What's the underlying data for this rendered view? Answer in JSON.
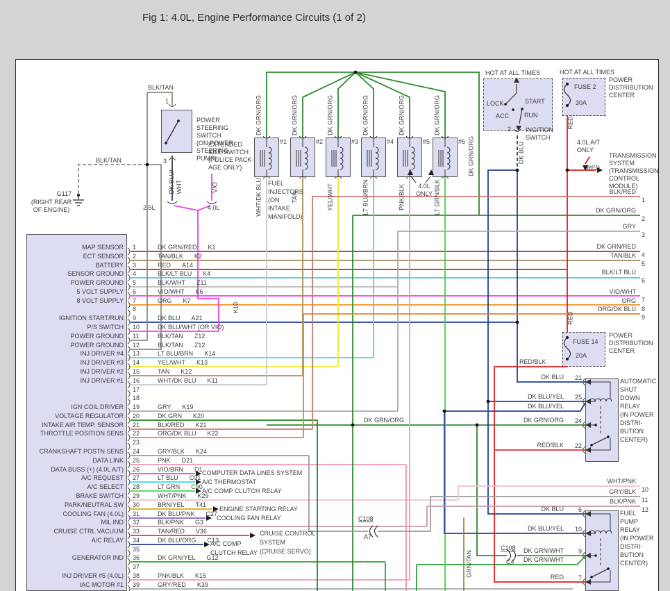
{
  "title": "Fig 1: 4.0L, Engine Performance Circuits (1 of 2)",
  "colors": {
    "DK GRN/RED": "#9b3a32",
    "TAN/BLK": "#a08a5a",
    "RED": "#e31b1b",
    "BLK/LT BLU": "#4cc7c7",
    "BLK/WHT": "#b8b8b8",
    "VIO/WHT": "#ef3fe8",
    "ORG": "#f0921e",
    "DK BLU": "#20409a",
    "DK BLU/WHT (OR VIO)": "#ef3fe8",
    "BLK/TAN": "#8d8d83",
    "LT BLU/BRN": "#35dede",
    "YEL/WHT": "#ecec22",
    "TAN": "#ab9154",
    "WHT/DK BLU": "#c9c9d2",
    "GRY": "#ababab",
    "DK GRN": "#1d8a1d",
    "BLK/RED": "#c77a70",
    "ORG/DK BLU": "#e0862b",
    "GRY/BLK": "#9b9b9b",
    "PNK": "#f392b4",
    "VIO/BRN": "#e044e0",
    "LT BLU": "#2bdede",
    "LT GRN": "#46d846",
    "WHT/PNK": "#eec3cd",
    "BRN/YEL": "#cfae00",
    "DK BLU/PNK": "#8166c4",
    "BLK/PNK": "#c59ba6",
    "TAN/RED": "#d9412b",
    "DK BLU/ORG": "#273694",
    "DK GRN/YEL": "#2da42d",
    "PNK/BLK": "#f09cae",
    "GRY/RED": "#a6a6a6",
    "DK GRN/ORG": "#2e8b2e",
    "LT GRN/BLK": "#4ccf4c",
    "DK GRN/WHT": "#2f9e38",
    "DK BLU/YEL": "#2a3f9e",
    "RED/BLK": "#e33535",
    "GRN/TAN": "#7d9a48",
    "BLK": "#3c3c3c"
  },
  "left_connector": {
    "rows": [
      {
        "n": "1",
        "label": "MAP SENSOR",
        "wire": "DK GRN/RED",
        "code": "K1"
      },
      {
        "n": "2",
        "label": "ECT SENSOR",
        "wire": "TAN/BLK",
        "code": "K2"
      },
      {
        "n": "3",
        "label": "BATTERY",
        "wire": "RED",
        "code": "A14"
      },
      {
        "n": "4",
        "label": "SENSOR GROUND",
        "wire": "BLK/LT BLU",
        "code": "K4"
      },
      {
        "n": "5",
        "label": "POWER GROUND",
        "wire": "BLK/WHT",
        "code": "Z11"
      },
      {
        "n": "6",
        "label": "5 VOLT SUPPLY",
        "wire": "VIO/WHT",
        "code": "K6"
      },
      {
        "n": "7",
        "label": "8 VOLT SUPPLY",
        "wire": "ORG",
        "code": "K7"
      },
      {
        "n": "8",
        "label": "",
        "wire": "",
        "code": ""
      },
      {
        "n": "9",
        "label": "IGNITION START/RUN",
        "wire": "DK BLU",
        "code": "A21"
      },
      {
        "n": "10",
        "label": "P/S SWITCH",
        "wire": "DK BLU/WHT (OR VIO)",
        "code": ""
      },
      {
        "n": "11",
        "label": "POWER GROUND",
        "wire": "BLK/TAN",
        "code": "Z12"
      },
      {
        "n": "12",
        "label": "POWER GROUND",
        "wire": "BLK/TAN",
        "code": "Z12"
      },
      {
        "n": "13",
        "label": "INJ DRIVER #4",
        "wire": "LT BLU/BRN",
        "code": "K14"
      },
      {
        "n": "14",
        "label": "INJ DRIVER #3",
        "wire": "YEL/WHT",
        "code": "K13"
      },
      {
        "n": "15",
        "label": "INJ DRIVER #2",
        "wire": "TAN",
        "code": "K12"
      },
      {
        "n": "16",
        "label": "INJ DRIVER #1",
        "wire": "WHT/DK BLU",
        "code": "K11"
      },
      {
        "n": "17",
        "label": "",
        "wire": "",
        "code": ""
      },
      {
        "n": "18",
        "label": "",
        "wire": "",
        "code": ""
      },
      {
        "n": "19",
        "label": "IGN COIL DRIVER",
        "wire": "GRY",
        "code": "K19"
      },
      {
        "n": "20",
        "label": "VOLTAGE REGULATOR",
        "wire": "DK GRN",
        "code": "K20"
      },
      {
        "n": "21",
        "label": "INTAKE AIR TEMP. SENSOR",
        "wire": "BLK/RED",
        "code": "K21"
      },
      {
        "n": "22",
        "label": "THROTTLE POSITION SENS",
        "wire": "ORG/DK BLU",
        "code": "K22"
      },
      {
        "n": "23",
        "label": "",
        "wire": "",
        "code": ""
      },
      {
        "n": "24",
        "label": "CRANKSHAFT POSTN SENS",
        "wire": "GRY/BLK",
        "code": "K24"
      },
      {
        "n": "25",
        "label": "DATA LINK",
        "wire": "PNK",
        "code": "D21"
      },
      {
        "n": "26",
        "label": "DATA BUSS (+) (4.0L A/T)",
        "wire": "VIO/BRN",
        "code": "D1"
      },
      {
        "n": "27",
        "label": "A/C REQUEST",
        "wire": "LT BLU",
        "code": "C91"
      },
      {
        "n": "28",
        "label": "A/C SELECT",
        "wire": "LT GRN",
        "code": "C90"
      },
      {
        "n": "29",
        "label": "BRAKE SWITCH",
        "wire": "WHT/PNK",
        "code": "K29"
      },
      {
        "n": "30",
        "label": "PARK/NEUTRAL SW",
        "wire": "BRN/YEL",
        "code": "T41"
      },
      {
        "n": "31",
        "label": "COOLING FAN (4.0L)",
        "wire": "DK BLU/PNK",
        "code": "C27"
      },
      {
        "n": "32",
        "label": "MIL IND",
        "wire": "BLK/PNK",
        "code": "G3"
      },
      {
        "n": "33",
        "label": "CRUISE CTRL VACUUM",
        "wire": "TAN/RED",
        "code": "V36"
      },
      {
        "n": "34",
        "label": "A/C RELAY",
        "wire": "DK BLU/ORG",
        "code": "C13"
      },
      {
        "n": "35",
        "label": "",
        "wire": "",
        "code": ""
      },
      {
        "n": "36",
        "label": "GENERATOR IND",
        "wire": "DK GRN/YEL",
        "code": "G12"
      },
      {
        "n": "37",
        "label": "",
        "wire": "",
        "code": ""
      },
      {
        "n": "38",
        "label": "INJ DRIVER #5 (4.0L)",
        "wire": "PNK/BLK",
        "code": "K15"
      },
      {
        "n": "39",
        "label": "IAC MOTOR #1",
        "wire": "GRY/RED",
        "code": "K39"
      }
    ]
  },
  "right_pins": [
    {
      "wire": "BLK/RED",
      "n": "1"
    },
    {
      "wire": "DK GRN/ORG",
      "n": "2"
    },
    {
      "wire": "GRY",
      "n": "3"
    },
    {
      "wire": "DK GRN/RED",
      "n": "4"
    },
    {
      "wire": "TAN/BLK",
      "n": "5"
    },
    {
      "wire": "BLK/LT BLU",
      "n": "6"
    },
    {
      "wire": "VIO/WHT",
      "n": "7"
    },
    {
      "wire": "ORG",
      "n": "8"
    },
    {
      "wire": "ORG/DK BLU",
      "n": "9"
    },
    {
      "wire": "WHT/PNK",
      "n": "10"
    },
    {
      "wire": "GRY/BLK",
      "n": "11"
    },
    {
      "wire": "BLK/PNK",
      "n": "12"
    }
  ],
  "injectors": {
    "title": "FUEL\nINJECTORS\n(ON\nINTAKE\nMANIFOLD)",
    "top_wire": "DK GRN/ORG",
    "right_wire": "DK GRN/ORG",
    "note": "4.0L\nONLY",
    "items": [
      {
        "n": "#1",
        "wire": "WHT/DK BLU"
      },
      {
        "n": "#2",
        "wire": "TAN"
      },
      {
        "n": "#3",
        "wire": "YEL/WHT"
      },
      {
        "n": "#4",
        "wire": "LT BLU/BRN"
      },
      {
        "n": "#5",
        "wire": "PNK/BLK"
      },
      {
        "n": "#6",
        "wire": "LT GRN/BLK"
      }
    ]
  },
  "ps": {
    "label": "POWER\nSTEERING\nSWITCH\n(ON POWER\nSTEERING\nPUMP)",
    "pin_top": "1",
    "pin_bottom": "3",
    "wire_top": "BLK/TAN",
    "wire_bottom": "DK BLU/\nWHT",
    "ext": "EXTENDED\nIDLE SWITCH\n(POLICE PACK-\nAGE ONLY)",
    "ext_wire": "VIO",
    "engines": [
      "2.5L",
      "4.0L"
    ],
    "k10": "K10"
  },
  "ground": {
    "id": "G117",
    "loc": "(RIGHT REAR\nOF ENGINE)",
    "wire": "BLK/TAN"
  },
  "ignition": {
    "hot": "HOT AT ALL TIMES",
    "lock": "LOCK",
    "acc": "ACC",
    "start": "START",
    "run": "RUN",
    "pin": "2",
    "label": "INGITION\nSWITCH",
    "wire": "DK BLU"
  },
  "fuse2": {
    "hot": "HOT AT ALL TIMES",
    "name": "FUSE 2",
    "rating": "30A",
    "box": "POWER\nDISTRIBUTION\nCENTER",
    "wire": "RED"
  },
  "trans": {
    "note": "4.0L A/T\nONLY",
    "wire": "RED",
    "label": "TRANSMISSION\nSYSTEM\n(TRANSMISSION\nCONTROL\nMODULE)"
  },
  "fuse14": {
    "name": "FUSE 14",
    "rating": "20A",
    "box": "POWER\nDISTRIBUTION\nCENTER",
    "wire_in": "RED",
    "wire_out": "RED/BLK"
  },
  "asd": {
    "label": "AUTOMATIC\nSHUT\nDOWN\nRELAY\n(IN POWER\nDISTRI-\nBUTION\nCENTER)",
    "pins": [
      {
        "wire": "DK BLU",
        "n": "21"
      },
      {
        "wire": "DK BLU/YEL",
        "n": "25"
      },
      {
        "wire": "DK BLU/YEL",
        "n": ""
      },
      {
        "wire": "DK GRN/ORG",
        "n": "24"
      },
      {
        "wire": "RED/BLK",
        "n": "22"
      }
    ]
  },
  "fuel_pump": {
    "label": "FUEL\nPUMP\nRELAY\n(IN POWER\nDISTRI-\nBUTION\nCENTER)",
    "pins": [
      {
        "wire": "DK BLU",
        "n": "6"
      },
      {
        "wire": "DK BLU/YEL",
        "n": "10"
      },
      {
        "wire": "DK GRN/WHT",
        "n": "9"
      },
      {
        "wire": "DK GRN/WHT",
        "n": ""
      },
      {
        "wire": "RED",
        "n": "7"
      }
    ]
  },
  "connectors": {
    "c108_left": {
      "name": "C108",
      "pin": "A7"
    },
    "c108_right": {
      "name": "C108",
      "pin": "C4"
    }
  },
  "mid_labels": {
    "dk_grn_org": "DK GRN/ORG",
    "grn_tan": "GRN/TAN",
    "red_blk": "RED/BLK"
  },
  "targets": {
    "computer": "COMPUTER DATA LINES SYSTEM",
    "thermostat": "A/C THERMOSTAT",
    "accomp": "A/C COMP CLUTCH RELAY",
    "starting": "ENGINE STARTING RELAY",
    "cooling": "COOLING FAN RELAY",
    "accomp2": "A/C COMP\nCLUTCH RELAY",
    "cruise": "CRUISE CONTROL\nSYSTEM\n(CRUISE SERVO)"
  }
}
